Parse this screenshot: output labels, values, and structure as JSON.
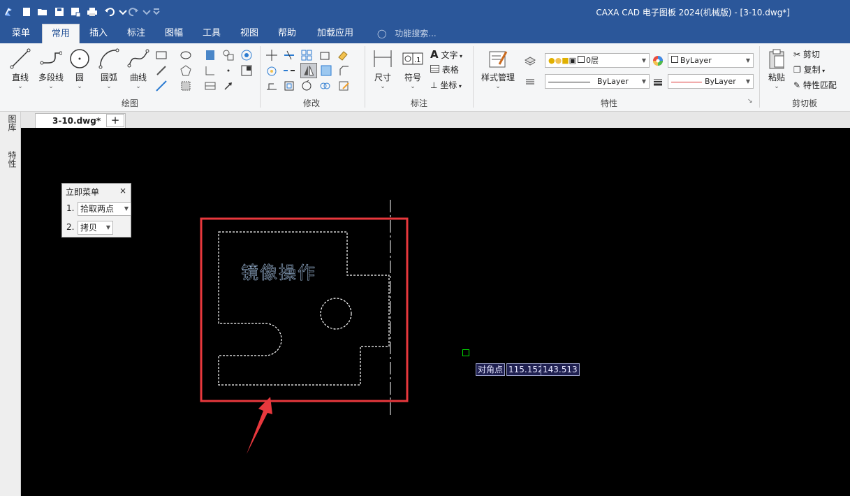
{
  "window": {
    "title": "CAXA CAD 电子图板 2024(机械版) - [3-10.dwg*]"
  },
  "menu": {
    "tabs": [
      {
        "label": "菜单"
      },
      {
        "label": "常用"
      },
      {
        "label": "插入"
      },
      {
        "label": "标注"
      },
      {
        "label": "图幅"
      },
      {
        "label": "工具"
      },
      {
        "label": "视图"
      },
      {
        "label": "帮助"
      },
      {
        "label": "加载应用"
      }
    ],
    "active_tab": "常用",
    "search_placeholder": "功能搜索..."
  },
  "ribbon": {
    "groups": {
      "draw": "绘图",
      "modify": "修改",
      "annotate": "标注",
      "properties": "特性",
      "clipboard": "剪切板"
    },
    "draw": {
      "line": "直线",
      "polyline": "多段线",
      "circle": "圆",
      "arc": "圆弧",
      "curve": "曲线"
    },
    "annotate": {
      "dimension": "尺寸",
      "symbol": "符号",
      "text": "文字",
      "table": "表格",
      "coordinate": "坐标"
    },
    "properties": {
      "style_manager": "样式管理",
      "layer": "0层",
      "color": "ByLayer",
      "linetype": "ByLayer",
      "lineweight": "ByLayer"
    },
    "clipboard": {
      "paste": "粘贴",
      "cut": "剪切",
      "copy": "复制",
      "match": "特性匹配"
    }
  },
  "document": {
    "tab": "3-10.dwg*",
    "close": "×",
    "new_tab": "+"
  },
  "side_panels": {
    "layers": "图库",
    "properties": "特性"
  },
  "immediate_menu": {
    "title": "立即菜单",
    "close": "×",
    "items": [
      {
        "index": "1.",
        "value": "拾取两点"
      },
      {
        "index": "2.",
        "value": "拷贝"
      }
    ]
  },
  "drawing": {
    "text": "镜像操作"
  },
  "coordinate_input": {
    "label": "对角点",
    "x": "115.152",
    "y": "143.513"
  },
  "colors": {
    "title_blue": "#2b579a",
    "canvas": "#000000",
    "highlight_red": "#e8383d",
    "cursor_green": "#00e000"
  }
}
